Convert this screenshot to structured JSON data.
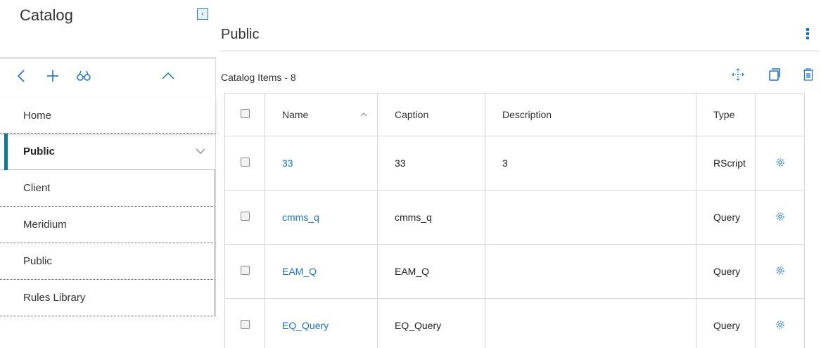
{
  "sidebar": {
    "title": "Catalog",
    "collapse_glyph": "‹",
    "toolbar_icons": [
      "back-icon",
      "add-icon",
      "binoculars-icon",
      "chevron-up-icon"
    ],
    "items": [
      {
        "label": "Home"
      },
      {
        "label": "Public",
        "active": true,
        "expanded": true
      },
      {
        "label": "Client"
      },
      {
        "label": "Meridium"
      },
      {
        "label": "Public"
      },
      {
        "label": "Rules Library"
      }
    ]
  },
  "main": {
    "title": "Public",
    "items_label": "Catalog Items - 8",
    "action_icons": [
      "move-icon",
      "copy-icon",
      "delete-icon",
      "kebab-menu-icon"
    ],
    "table": {
      "columns": [
        "Name",
        "Caption",
        "Description",
        "Type"
      ],
      "sort_column": "Name",
      "sort_direction": "ascending",
      "rows": [
        {
          "name": "33",
          "caption": "33",
          "description": "3",
          "type": "RScript"
        },
        {
          "name": "cmms_q",
          "caption": "cmms_q",
          "description": "",
          "type": "Query"
        },
        {
          "name": "EAM_Q",
          "caption": "EAM_Q",
          "description": "",
          "type": "Query"
        },
        {
          "name": "EQ_Query",
          "caption": "EQ_Query",
          "description": "",
          "type": "Query"
        }
      ]
    }
  },
  "colors": {
    "accent": "#1a73c9",
    "active_marker": "#0f7b8f"
  }
}
